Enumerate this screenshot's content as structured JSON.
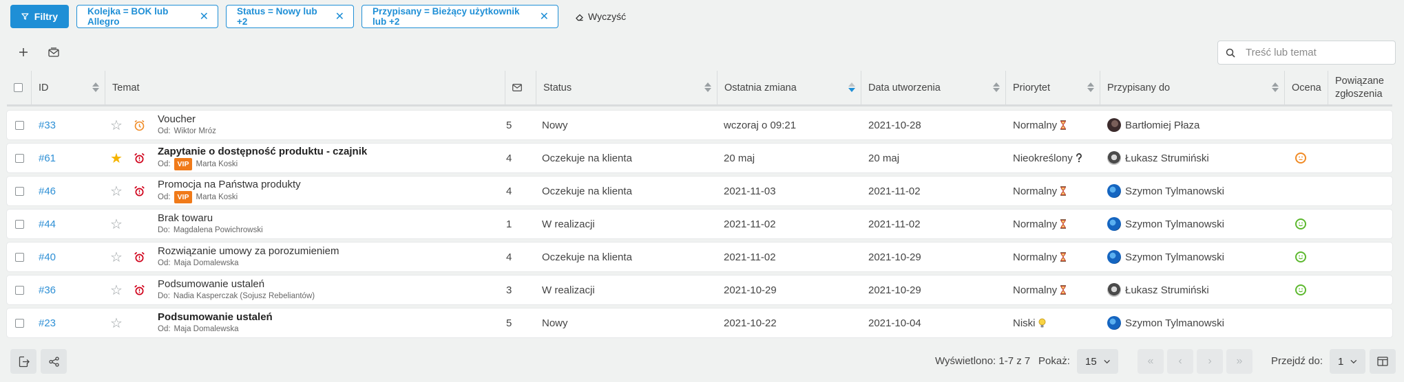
{
  "filters": {
    "button_label": "Filtry",
    "chips": [
      {
        "label": "Kolejka = BOK lub Allegro"
      },
      {
        "label": "Status = Nowy lub +2"
      },
      {
        "label": "Przypisany = Bieżący użytkownik lub +2"
      }
    ],
    "clear_label": "Wyczyść"
  },
  "toolbar": {
    "add_icon": "plus-icon",
    "compose_icon": "envelope-icon"
  },
  "search": {
    "placeholder": "Treść lub temat"
  },
  "table": {
    "headers": {
      "id": "ID",
      "topic": "Temat",
      "messages_icon": "envelope-icon",
      "status": "Status",
      "last_change": "Ostatnia zmiana",
      "created": "Data utworzenia",
      "priority": "Priorytet",
      "assigned": "Przypisany do",
      "rating": "Ocena",
      "related_1": "Powiązane",
      "related_2": "zgłoszenia"
    },
    "sorted_column": "last_change",
    "sort_direction": "desc",
    "rows": [
      {
        "id": "#33",
        "starred": false,
        "alarm": "clock-orange",
        "title": "Voucher",
        "title_bold": false,
        "sub_prefix": "Od:",
        "vip": false,
        "vip_label": "",
        "sub_name": "Wiktor Mróz",
        "messages": "5",
        "status": "Nowy",
        "last_change": "wczoraj o 09:21",
        "created": "2021-10-28",
        "priority": "Normalny",
        "priority_icon": "hourglass-icon",
        "assignee": "Bartłomiej Płaza",
        "avatar": "bp",
        "rating": ""
      },
      {
        "id": "#61",
        "starred": true,
        "alarm": "alarm-red",
        "title": "Zapytanie o dostępność produktu - czajnik",
        "title_bold": true,
        "sub_prefix": "Od:",
        "vip": true,
        "vip_label": "VIP",
        "sub_name": "Marta Koski",
        "messages": "4",
        "status": "Oczekuje na klienta",
        "last_change": "20 maj",
        "created": "20 maj",
        "priority": "Nieokreślony",
        "priority_icon": "question-icon",
        "assignee": "Łukasz Strumiński",
        "avatar": "ls",
        "rating": "neutral"
      },
      {
        "id": "#46",
        "starred": false,
        "alarm": "alarm-red",
        "title": "Promocja na Państwa produkty",
        "title_bold": false,
        "sub_prefix": "Od:",
        "vip": true,
        "vip_label": "VIP",
        "sub_name": "Marta Koski",
        "messages": "4",
        "status": "Oczekuje na klienta",
        "last_change": "2021-11-03",
        "created": "2021-11-02",
        "priority": "Normalny",
        "priority_icon": "hourglass-icon",
        "assignee": "Szymon Tylmanowski",
        "avatar": "st",
        "rating": ""
      },
      {
        "id": "#44",
        "starred": false,
        "alarm": "",
        "title": "Brak towaru",
        "title_bold": false,
        "sub_prefix": "Do:",
        "vip": false,
        "vip_label": "",
        "sub_name": "Magdalena Powichrowski",
        "messages": "1",
        "status": "W realizacji",
        "last_change": "2021-11-02",
        "created": "2021-11-02",
        "priority": "Normalny",
        "priority_icon": "hourglass-icon",
        "assignee": "Szymon Tylmanowski",
        "avatar": "st",
        "rating": "happy"
      },
      {
        "id": "#40",
        "starred": false,
        "alarm": "alarm-red",
        "title": "Rozwiązanie umowy za porozumieniem",
        "title_bold": false,
        "sub_prefix": "Od:",
        "vip": false,
        "vip_label": "",
        "sub_name": "Maja Domalewska",
        "messages": "4",
        "status": "Oczekuje na klienta",
        "last_change": "2021-11-02",
        "created": "2021-10-29",
        "priority": "Normalny",
        "priority_icon": "hourglass-icon",
        "assignee": "Szymon Tylmanowski",
        "avatar": "st",
        "rating": "happy"
      },
      {
        "id": "#36",
        "starred": false,
        "alarm": "alarm-red",
        "title": "Podsumowanie ustaleń",
        "title_bold": false,
        "sub_prefix": "Do:",
        "vip": false,
        "vip_label": "",
        "sub_name": "Nadia Kasperczak (Sojusz Rebeliantów)",
        "messages": "3",
        "status": "W realizacji",
        "last_change": "2021-10-29",
        "created": "2021-10-29",
        "priority": "Normalny",
        "priority_icon": "hourglass-icon",
        "assignee": "Łukasz Strumiński",
        "avatar": "ls",
        "rating": "happy"
      },
      {
        "id": "#23",
        "starred": false,
        "alarm": "",
        "title": "Podsumowanie ustaleń",
        "title_bold": true,
        "sub_prefix": "Od:",
        "vip": false,
        "vip_label": "",
        "sub_name": "Maja Domalewska",
        "messages": "5",
        "status": "Nowy",
        "last_change": "2021-10-22",
        "created": "2021-10-04",
        "priority": "Niski",
        "priority_icon": "lightbulb-icon",
        "assignee": "Szymon Tylmanowski",
        "avatar": "st",
        "rating": ""
      }
    ]
  },
  "footer": {
    "shown_text": "Wyświetlono: 1-7 z 7",
    "show_label": "Pokaż:",
    "page_size": "15",
    "goto_label": "Przejdź do:",
    "page": "1"
  },
  "colors": {
    "accent": "#1f8fd6",
    "vip": "#f07a19",
    "alarm": "#d0021b"
  }
}
